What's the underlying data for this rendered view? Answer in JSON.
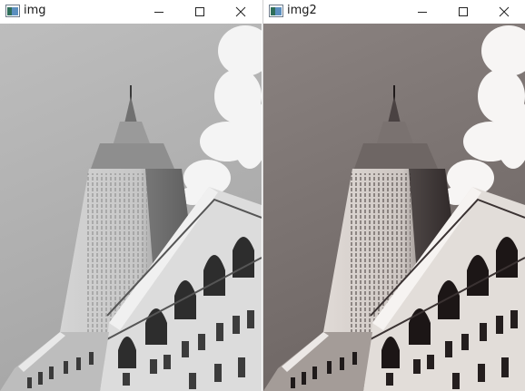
{
  "windows": [
    {
      "title": "img",
      "icons": [
        "app-icon",
        "minimize-icon",
        "maximize-icon",
        "close-icon"
      ]
    },
    {
      "title": "img2",
      "icons": [
        "app-icon",
        "minimize-icon",
        "maximize-icon",
        "close-icon"
      ]
    }
  ],
  "image": {
    "subject": "skyscraper-photo",
    "tone_left": "grayscale",
    "tone_right": "sepia-high-contrast"
  },
  "colors": {
    "sky_left": "#b4b4b4",
    "sky_right": "#8a8280",
    "building_left": "#cfcfcf",
    "building_right": "#d8d3cf",
    "shadow_left": "#3a3a3a",
    "shadow_right": "#2b2424"
  }
}
